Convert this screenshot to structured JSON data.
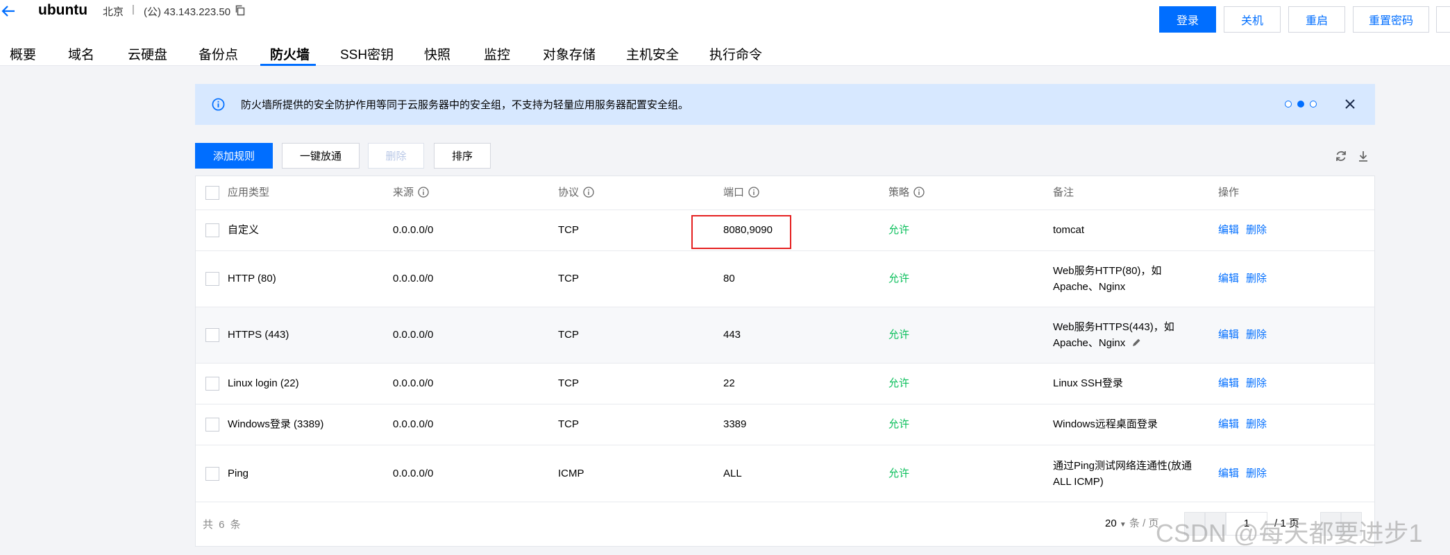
{
  "header": {
    "title": "ubuntu",
    "region": "北京",
    "separator": "|",
    "ip": "(公) 43.143.223.50",
    "buttons": {
      "login": "登录",
      "shutdown": "关机",
      "restart": "重启",
      "reset_password": "重置密码"
    }
  },
  "tabs": [
    "概要",
    "域名",
    "云硬盘",
    "备份点",
    "防火墙",
    "SSH密钥",
    "快照",
    "监控",
    "对象存储",
    "主机安全",
    "执行命令"
  ],
  "active_tab": "防火墙",
  "notice": {
    "text": "防火墙所提供的安全防护作用等同于云服务器中的安全组，不支持为轻量应用服务器配置安全组。",
    "dots": 3,
    "active_dot": 1
  },
  "toolbar": {
    "add_rule": "添加规则",
    "one_click_allow": "一键放通",
    "delete": "删除",
    "sort": "排序"
  },
  "table": {
    "columns": [
      "应用类型",
      "来源",
      "协议",
      "端口",
      "策略",
      "备注",
      "操作"
    ],
    "rows": [
      {
        "type": "自定义",
        "source": "0.0.0.0/0",
        "protocol": "TCP",
        "port": "8080,9090",
        "policy": "允许",
        "note": [
          "tomcat"
        ],
        "edit": "编辑",
        "delete": "删除"
      },
      {
        "type": "HTTP (80)",
        "source": "0.0.0.0/0",
        "protocol": "TCP",
        "port": "80",
        "policy": "允许",
        "note": [
          "Web服务HTTP(80)，如",
          "Apache、Nginx"
        ],
        "edit": "编辑",
        "delete": "删除"
      },
      {
        "type": "HTTPS (443)",
        "source": "0.0.0.0/0",
        "protocol": "TCP",
        "port": "443",
        "policy": "允许",
        "note": [
          "Web服务HTTPS(443)，如",
          "Apache、Nginx"
        ],
        "edit": "编辑",
        "delete": "删除"
      },
      {
        "type": "Linux login (22)",
        "source": "0.0.0.0/0",
        "protocol": "TCP",
        "port": "22",
        "policy": "允许",
        "note": [
          "Linux SSH登录"
        ],
        "edit": "编辑",
        "delete": "删除"
      },
      {
        "type": "Windows登录 (3389)",
        "source": "0.0.0.0/0",
        "protocol": "TCP",
        "port": "3389",
        "policy": "允许",
        "note": [
          "Windows远程桌面登录"
        ],
        "edit": "编辑",
        "delete": "删除"
      },
      {
        "type": "Ping",
        "source": "0.0.0.0/0",
        "protocol": "ICMP",
        "port": "ALL",
        "policy": "允许",
        "note": [
          "通过Ping测试网络连通性(放通",
          "ALL ICMP)"
        ],
        "edit": "编辑",
        "delete": "删除"
      }
    ]
  },
  "footer": {
    "total": "共 6 条",
    "page_size": "20",
    "per_page": "条 / 页",
    "current_page": "1",
    "total_pages": "/ 1 页"
  },
  "watermark": "CSDN @每天都要进步1",
  "colors": {
    "primary": "#006eff",
    "allow": "#0abf5b",
    "notice_bg": "#d7e8ff",
    "highlight": "#e52020"
  }
}
